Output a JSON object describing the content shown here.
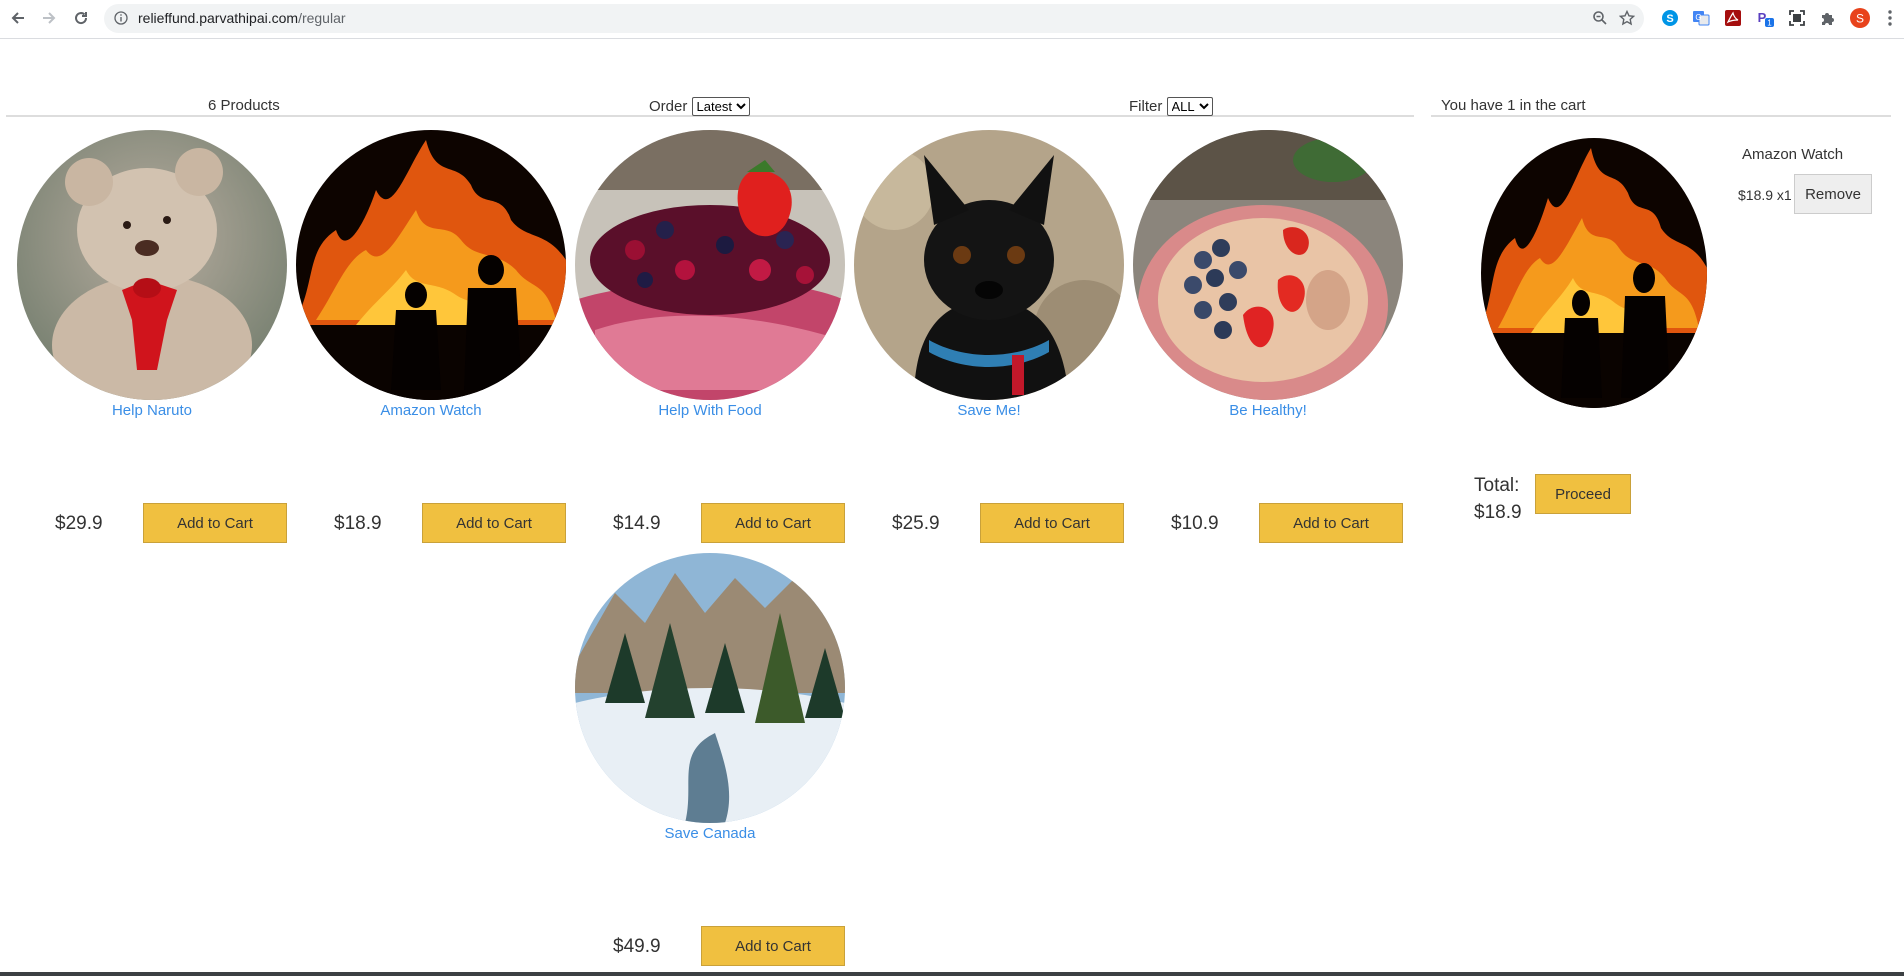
{
  "browser": {
    "url_host": "relieffund.parvathipai.com",
    "url_path": "/regular",
    "profile_initial": "S",
    "extension_badge": "1"
  },
  "filter_bar": {
    "count_text": "6 Products",
    "order_label": "Order",
    "order_selected": "Latest",
    "filter_label": "Filter",
    "filter_selected": "ALL"
  },
  "products": [
    {
      "title": "Help Naruto",
      "price": "$29.9",
      "add_label": "Add to Cart",
      "image": "teddy-bear"
    },
    {
      "title": "Amazon Watch",
      "price": "$18.9",
      "add_label": "Add to Cart",
      "image": "forest-fire"
    },
    {
      "title": "Help With Food",
      "price": "$14.9",
      "add_label": "Add to Cart",
      "image": "berries"
    },
    {
      "title": "Save Me!",
      "price": "$25.9",
      "add_label": "Add to Cart",
      "image": "french-bulldog"
    },
    {
      "title": "Be Healthy!",
      "price": "$10.9",
      "add_label": "Add to Cart",
      "image": "oatmeal-bowl"
    },
    {
      "title": "Save Canada",
      "price": "$49.9",
      "add_label": "Add to Cart",
      "image": "snowy-forest"
    }
  ],
  "cart": {
    "header": "You have 1 in the cart",
    "items": [
      {
        "title": "Amazon Watch",
        "qty_text": "$18.9 x1",
        "remove_label": "Remove",
        "image": "forest-fire"
      }
    ],
    "total_label": "Total:",
    "total_value": "$18.9",
    "proceed_label": "Proceed"
  }
}
